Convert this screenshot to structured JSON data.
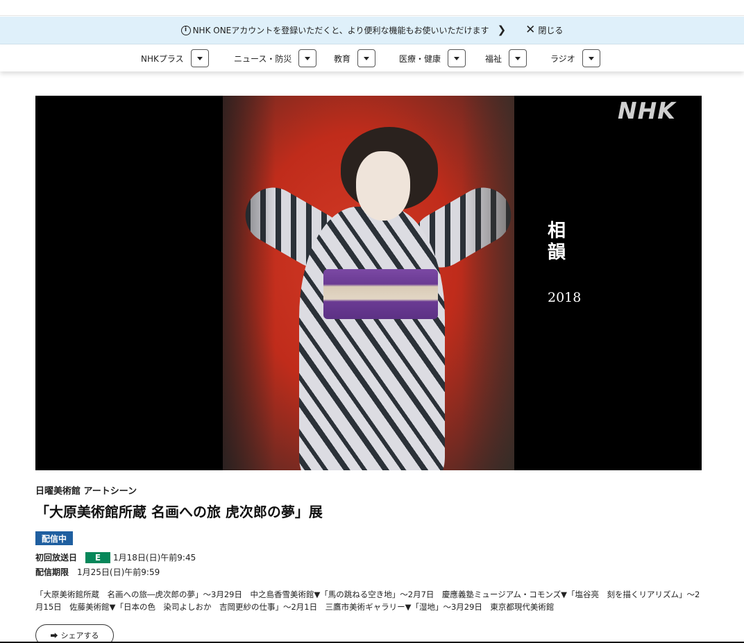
{
  "banner": {
    "info_icon": "i",
    "message": "NHK ONEアカウントを登録いただくと、より便利な機能もお使いいただけます",
    "close_label": "閉じる"
  },
  "nav": {
    "items": [
      {
        "label": "NHKプラス"
      },
      {
        "label": "ニュース・防災"
      },
      {
        "label": "教育"
      },
      {
        "label": "医療・健康"
      },
      {
        "label": "福祉"
      },
      {
        "label": "ラジオ"
      }
    ]
  },
  "hero": {
    "logo": "NHK",
    "poem_title": "相韻",
    "poem_year": "2018"
  },
  "program": {
    "series": "日曜美術館 アートシーン",
    "title": "「大原美術館所蔵 名画への旅 虎次郎の夢」展",
    "status_badge": "配信中",
    "broadcast_label": "初回放送日",
    "channel": "E",
    "broadcast_date": "1月18日(日)午前9:45",
    "deadline_label": "配信期限",
    "deadline_date": "1月25日(日)午前9:59",
    "description": "「大原美術館所蔵　名画への旅―虎次郎の夢」～3月29日　中之島香雪美術館▼「馬の跳ねる空き地」～2月7日　慶應義塾ミュージアム・コモンズ▼「塩谷亮　刻を描くリアリズム」～2月15日　佐藤美術館▼「日本の色　染司よしおか　吉岡更紗の仕事」～2月1日　三鷹市美術ギャラリー▼「湿地」～3月29日　東京都現代美術館"
  },
  "share": {
    "label": "シェアする",
    "icon": "share-icon"
  },
  "colors": {
    "banner_bg": "#dff0fa",
    "badge_blue": "#1f5fa0",
    "channel_green": "#07875a"
  }
}
